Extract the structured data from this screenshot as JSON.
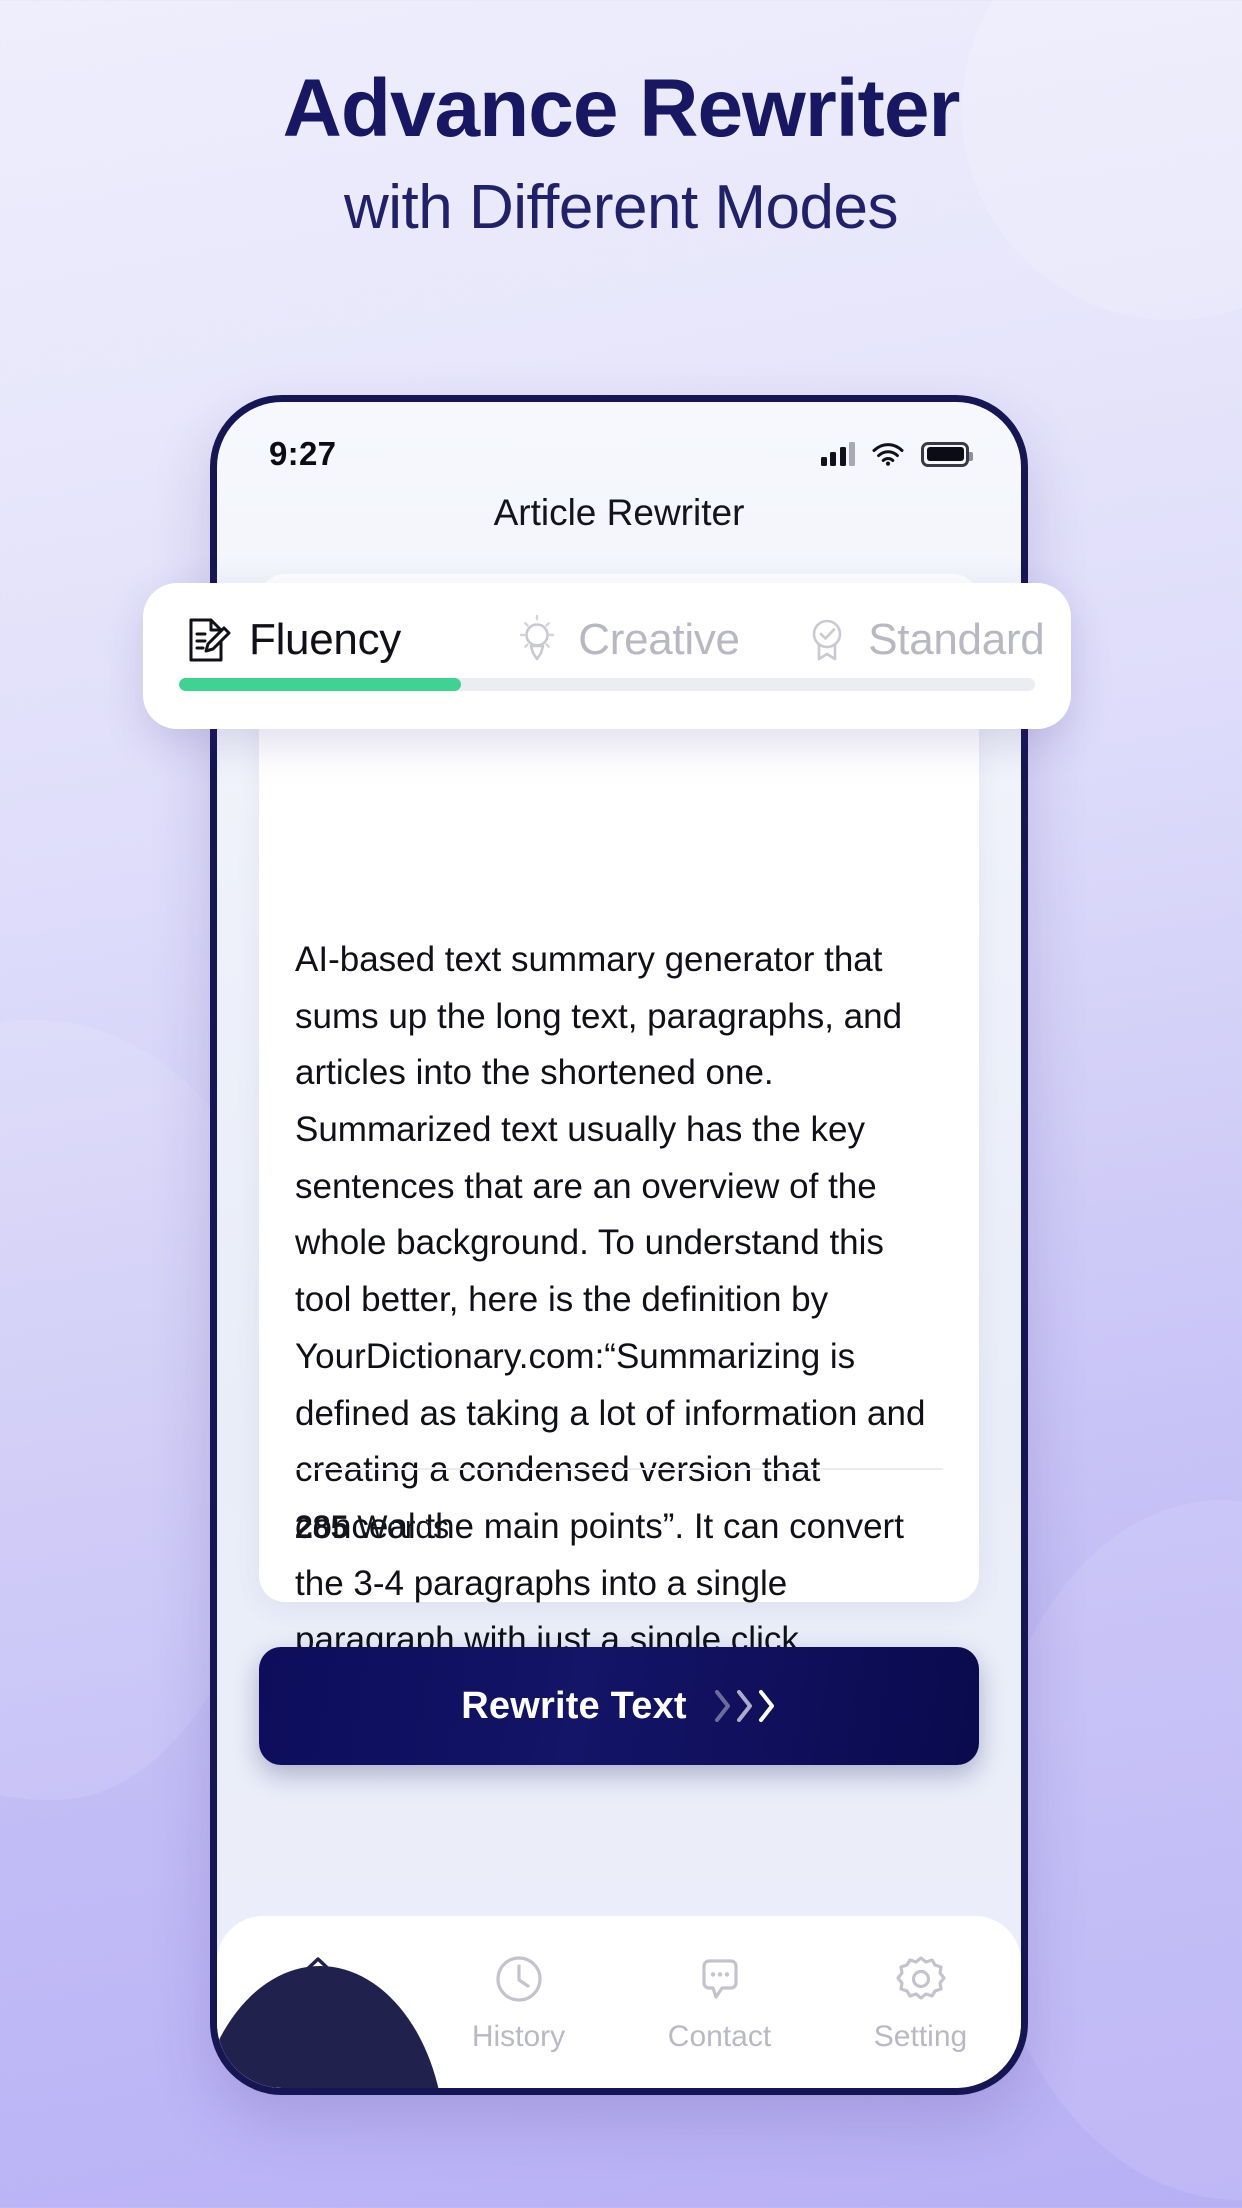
{
  "hero": {
    "title": "Advance Rewriter",
    "subtitle": "with Different Modes"
  },
  "colors": {
    "title": "#171763",
    "accent_green": "#3ed392",
    "button_navy": "#0d0d5c",
    "muted": "#b8b8c2"
  },
  "phone": {
    "status_bar": {
      "time": "9:27",
      "icons": [
        "signal-bars-icon",
        "wifi-icon",
        "battery-icon"
      ]
    },
    "header": {
      "title": "Article Rewriter"
    },
    "mode_card": {
      "progress_percent": 33,
      "tabs": [
        {
          "label": "Fluency",
          "icon": "document-pen-icon",
          "active": true
        },
        {
          "label": "Creative",
          "icon": "lightbulb-icon",
          "active": false
        },
        {
          "label": "Standard",
          "icon": "badge-check-icon",
          "active": false
        }
      ]
    },
    "content": {
      "article_text": "AI-based text summary generator that sums up the long text, paragraphs, and articles into the shortened one. Summarized text usually has the key sentences that are an overview of the whole background. To understand this tool better, here is the definition by YourDictionary.com:“Summarizing is defined as taking a lot of information and creating a condensed version that conceal the main points”. It can convert the 3-4 paragraphs into a single paragraph with just a single click.",
      "word_count_number": "285",
      "word_count_label": "Words"
    },
    "rewrite_button": {
      "label": "Rewrite Text",
      "icon": "triple-chevron-right-icon"
    },
    "bottom_nav": [
      {
        "label": "",
        "icon": "home-icon",
        "active": true
      },
      {
        "label": "History",
        "icon": "clock-icon",
        "active": false
      },
      {
        "label": "Contact",
        "icon": "chat-dots-icon",
        "active": false
      },
      {
        "label": "Setting",
        "icon": "gear-icon",
        "active": false
      }
    ]
  }
}
